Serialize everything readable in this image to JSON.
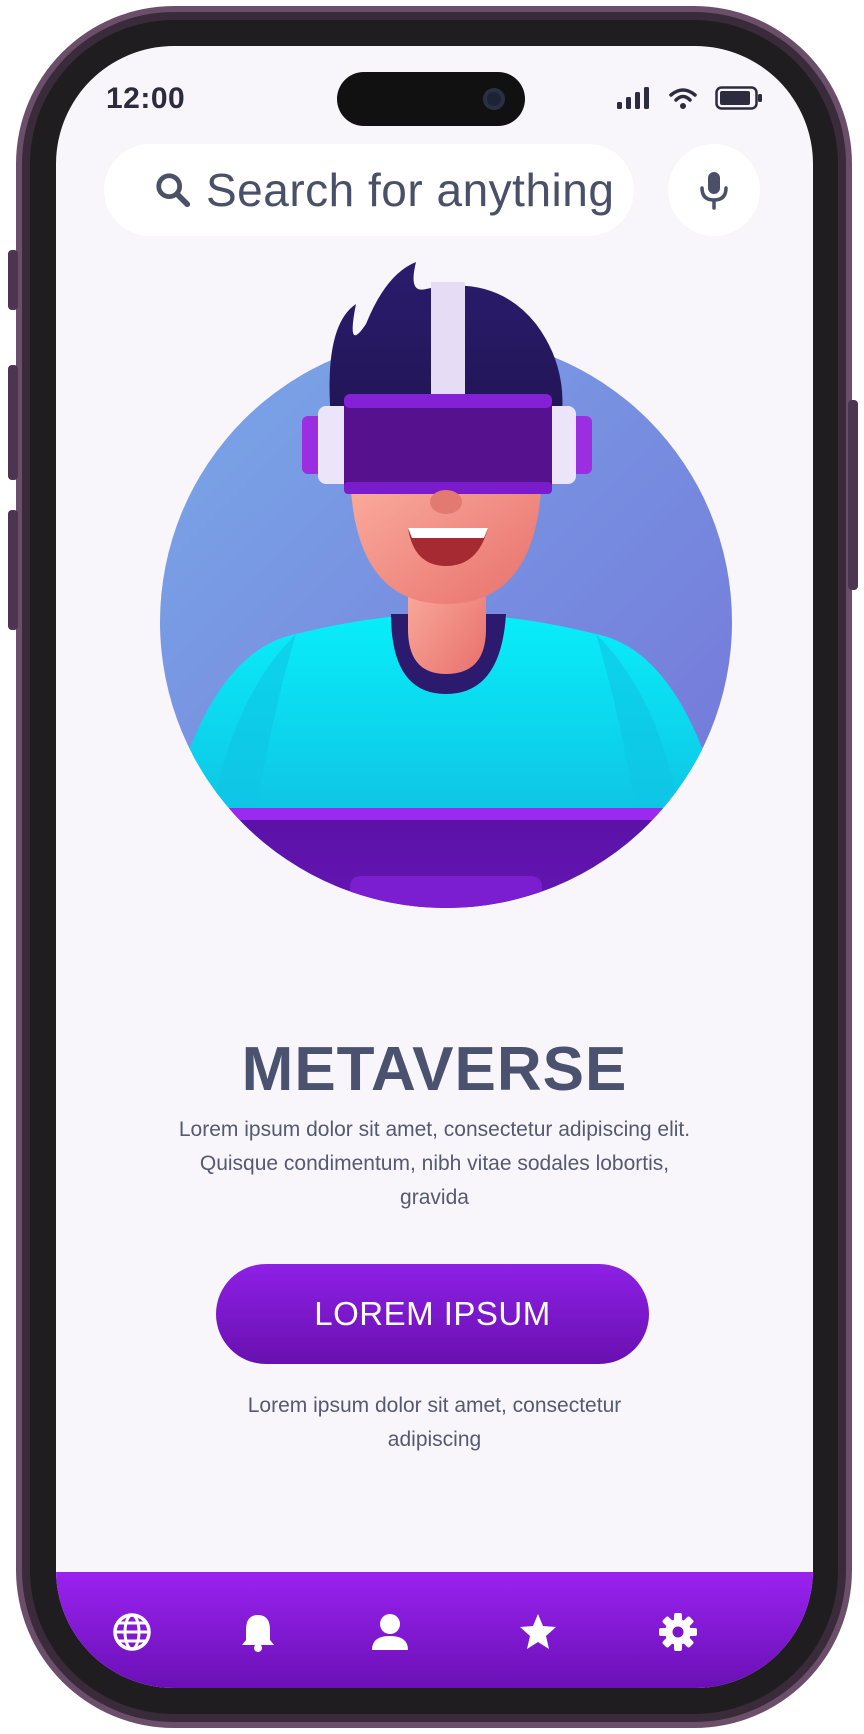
{
  "status_bar": {
    "time": "12:00"
  },
  "search": {
    "placeholder": "Search for anything",
    "icon": "search-icon",
    "mic_icon": "microphone-icon"
  },
  "hero": {
    "title": "METAVERSE",
    "description": "Lorem ipsum dolor sit amet, consectetur adipiscing elit. Quisque condimentum, nibh vitae sodales lobortis, gravida",
    "cta_label": "LOREM IPSUM",
    "note": "Lorem ipsum dolor sit amet, consectetur adipiscing"
  },
  "nav": {
    "items": [
      {
        "icon": "globe-icon"
      },
      {
        "icon": "bell-icon"
      },
      {
        "icon": "user-icon"
      },
      {
        "icon": "star-icon"
      },
      {
        "icon": "gear-icon"
      }
    ]
  },
  "colors": {
    "accent": "#8a1fe0",
    "accent_dark": "#6a10b6",
    "background": "#f8f5fb",
    "text": "#4a5270",
    "frame": "#6a4e6a"
  }
}
